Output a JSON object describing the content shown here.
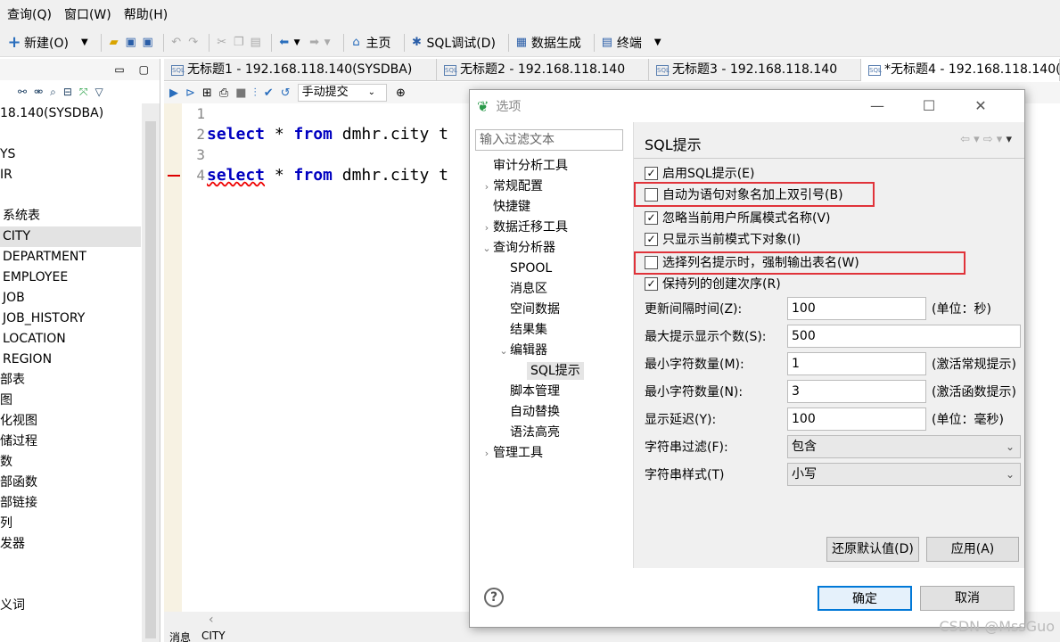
{
  "menu": [
    "查询(Q)",
    "窗口(W)",
    "帮助(H)"
  ],
  "toolbar": {
    "new_label": "新建(O)",
    "home_label": "主页",
    "sqldebug_label": "SQL调试(D)",
    "datagen_label": "数据生成",
    "terminal_label": "终端"
  },
  "left_tree": [
    "18.140(SYSDBA)",
    "",
    "YS",
    "IR",
    "",
    "系统表",
    "CITY",
    "DEPARTMENT",
    "EMPLOYEE",
    "JOB",
    "JOB_HISTORY",
    "LOCATION",
    "REGION",
    "部表",
    "图",
    "化视图",
    "储过程",
    "数",
    "部函数",
    "部链接",
    "列",
    "发器",
    "",
    "",
    "义词"
  ],
  "tabs": [
    "无标题1 - 192.168.118.140(SYSDBA)",
    "无标题2 - 192.168.118.140",
    "无标题3 - 192.168.118.140",
    "*无标题4 - 192.168.118.140("
  ],
  "editor": {
    "commit_mode": "手动提交",
    "lines": [
      {
        "no": "1",
        "kw1": "",
        "mid": "",
        "kw2": "",
        "rest": ""
      },
      {
        "no": "2",
        "kw1": "select",
        "mid": " * ",
        "kw2": "from",
        "rest": " dmhr.city t"
      },
      {
        "no": "3",
        "kw1": "",
        "mid": "",
        "kw2": "",
        "rest": ""
      },
      {
        "no": "4",
        "kw1": "select",
        "mid": " * ",
        "kw2": "from",
        "rest": " dmhr.city t"
      }
    ]
  },
  "bottom_tabs": [
    "消息",
    "CITY"
  ],
  "dialog": {
    "title": "选项",
    "filter_placeholder": "输入过滤文本",
    "nav": [
      {
        "label": "审计分析工具",
        "arrow": "",
        "indent": 0
      },
      {
        "label": "常规配置",
        "arrow": "›",
        "indent": 0
      },
      {
        "label": "快捷键",
        "arrow": "",
        "indent": 0
      },
      {
        "label": "数据迁移工具",
        "arrow": "›",
        "indent": 0
      },
      {
        "label": "查询分析器",
        "arrow": "⌄",
        "indent": 0
      },
      {
        "label": "SPOOL",
        "arrow": "",
        "indent": 1
      },
      {
        "label": "消息区",
        "arrow": "",
        "indent": 1
      },
      {
        "label": "空间数据",
        "arrow": "",
        "indent": 1
      },
      {
        "label": "结果集",
        "arrow": "",
        "indent": 1
      },
      {
        "label": "编辑器",
        "arrow": "⌄",
        "indent": 1
      },
      {
        "label": "SQL提示",
        "arrow": "",
        "indent": 2
      },
      {
        "label": "脚本管理",
        "arrow": "",
        "indent": 1
      },
      {
        "label": "自动替换",
        "arrow": "",
        "indent": 1
      },
      {
        "label": "语法高亮",
        "arrow": "",
        "indent": 1
      },
      {
        "label": "管理工具",
        "arrow": "›",
        "indent": 0
      }
    ],
    "section_title": "SQL提示",
    "checkboxes": [
      {
        "label": "启用SQL提示(E)",
        "checked": true
      },
      {
        "label": "自动为语句对象名加上双引号(B)",
        "checked": false
      },
      {
        "label": "忽略当前用户所属模式名称(V)",
        "checked": true
      },
      {
        "label": "只显示当前模式下对象(I)",
        "checked": true
      },
      {
        "label": "选择列名提示时，强制输出表名(W)",
        "checked": false
      },
      {
        "label": "保持列的创建次序(R)",
        "checked": true
      }
    ],
    "fields": [
      {
        "label": "更新间隔时间(Z):",
        "value": "100",
        "unit": "(单位：秒)"
      },
      {
        "label": "最大提示显示个数(S):",
        "value": "500",
        "unit": ""
      },
      {
        "label": "最小字符数量(M):",
        "value": "1",
        "unit": "(激活常规提示)"
      },
      {
        "label": "最小字符数量(N):",
        "value": "3",
        "unit": "(激活函数提示)"
      },
      {
        "label": "显示延迟(Y):",
        "value": "100",
        "unit": "(单位：毫秒)"
      }
    ],
    "selects": [
      {
        "label": "字符串过滤(F):",
        "value": "包含"
      },
      {
        "label": "字符串样式(T)",
        "value": "小写"
      }
    ],
    "restore_label": "还原默认值(D)",
    "apply_label": "应用(A)",
    "ok_label": "确定",
    "cancel_label": "取消"
  },
  "watermark": "CSDN @MssGuo"
}
